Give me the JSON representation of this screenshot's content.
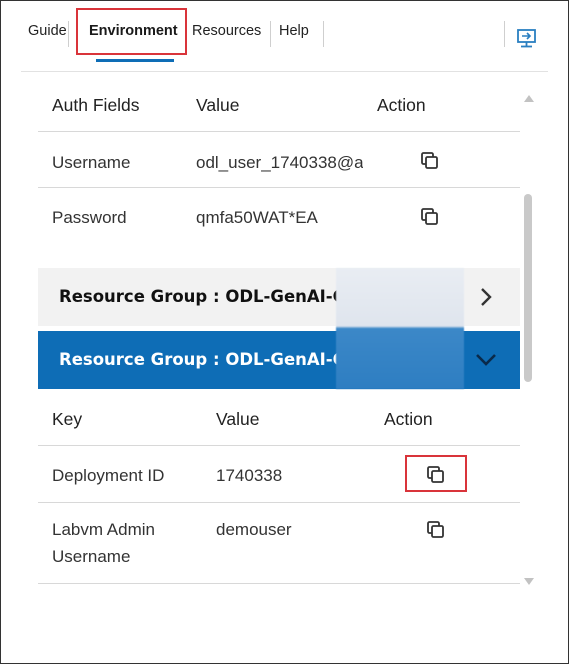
{
  "tabs": {
    "guide": "Guide",
    "environment": "Environment",
    "resources": "Resources",
    "help": "Help"
  },
  "auth_table": {
    "headers": {
      "field": "Auth Fields",
      "value": "Value",
      "action": "Action"
    },
    "rows": [
      {
        "field": "Username",
        "value": "odl_user_1740338@a"
      },
      {
        "field": "Password",
        "value": "qmfa50WAT*EA"
      }
    ]
  },
  "resource_groups": [
    {
      "title": "Resource Group : ODL-GenAI-CI",
      "state": "collapsed"
    },
    {
      "title": "Resource Group : ODL-GenAI-CI",
      "state": "expanded"
    }
  ],
  "resource_table": {
    "headers": {
      "key": "Key",
      "value": "Value",
      "action": "Action"
    },
    "rows": [
      {
        "key": "Deployment ID",
        "value": "1740338"
      },
      {
        "key_line1": "Labvm Admin",
        "key_line2": "Username",
        "value": "demouser"
      }
    ]
  },
  "icons": {
    "copy": "copy-icon",
    "chevron_right": "chevron-right-icon",
    "chevron_down": "chevron-down-icon",
    "monitor": "monitor-split-icon"
  },
  "colors": {
    "accent": "#0e6db6",
    "highlight": "#d9343a",
    "collapsed_bar": "#f2f2f2"
  }
}
